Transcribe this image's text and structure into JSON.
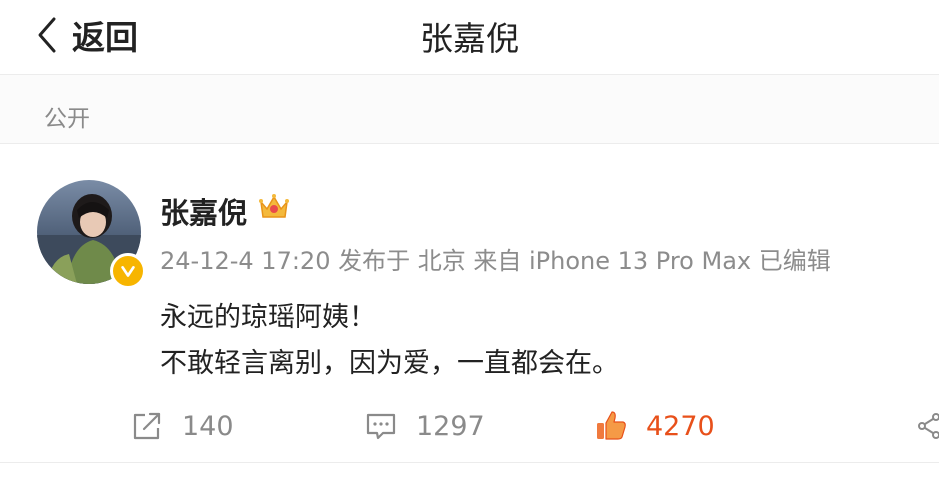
{
  "header": {
    "back_label": "返回",
    "title": "张嘉倪"
  },
  "section": {
    "label": "公开"
  },
  "post": {
    "author": "张嘉倪",
    "meta": "24-12-4 17:20 发布于 北京 来自 iPhone 13 Pro Max 已编辑",
    "lines": [
      "永远的琼瑶阿姨！",
      "不敢轻言离别，因为爱，一直都会在。"
    ],
    "actions": {
      "repost_count": "140",
      "comment_count": "1297",
      "like_count": "4270"
    },
    "icons": {
      "back": "chevron-left-icon",
      "repost": "share-icon",
      "comment": "comment-icon",
      "like": "thumbs-up-icon",
      "more": "share-more-icon",
      "crown": "crown-icon",
      "verified": "verified-badge-icon"
    },
    "colors": {
      "like": "#e8501a",
      "verified": "#f7b500"
    }
  }
}
